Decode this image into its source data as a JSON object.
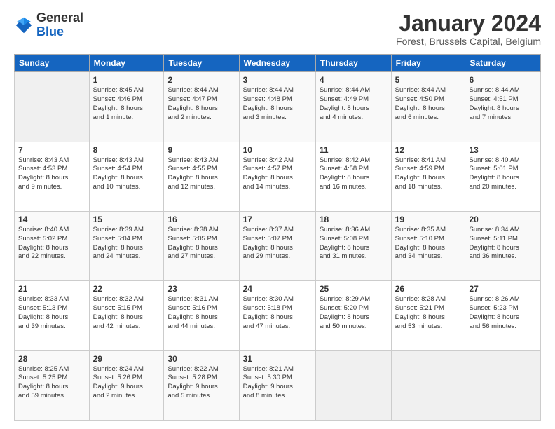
{
  "logo": {
    "general": "General",
    "blue": "Blue"
  },
  "header": {
    "title": "January 2024",
    "subtitle": "Forest, Brussels Capital, Belgium"
  },
  "days_of_week": [
    "Sunday",
    "Monday",
    "Tuesday",
    "Wednesday",
    "Thursday",
    "Friday",
    "Saturday"
  ],
  "weeks": [
    [
      {
        "day": "",
        "text": ""
      },
      {
        "day": "1",
        "text": "Sunrise: 8:45 AM\nSunset: 4:46 PM\nDaylight: 8 hours\nand 1 minute."
      },
      {
        "day": "2",
        "text": "Sunrise: 8:44 AM\nSunset: 4:47 PM\nDaylight: 8 hours\nand 2 minutes."
      },
      {
        "day": "3",
        "text": "Sunrise: 8:44 AM\nSunset: 4:48 PM\nDaylight: 8 hours\nand 3 minutes."
      },
      {
        "day": "4",
        "text": "Sunrise: 8:44 AM\nSunset: 4:49 PM\nDaylight: 8 hours\nand 4 minutes."
      },
      {
        "day": "5",
        "text": "Sunrise: 8:44 AM\nSunset: 4:50 PM\nDaylight: 8 hours\nand 6 minutes."
      },
      {
        "day": "6",
        "text": "Sunrise: 8:44 AM\nSunset: 4:51 PM\nDaylight: 8 hours\nand 7 minutes."
      }
    ],
    [
      {
        "day": "7",
        "text": "Sunrise: 8:43 AM\nSunset: 4:53 PM\nDaylight: 8 hours\nand 9 minutes."
      },
      {
        "day": "8",
        "text": "Sunrise: 8:43 AM\nSunset: 4:54 PM\nDaylight: 8 hours\nand 10 minutes."
      },
      {
        "day": "9",
        "text": "Sunrise: 8:43 AM\nSunset: 4:55 PM\nDaylight: 8 hours\nand 12 minutes."
      },
      {
        "day": "10",
        "text": "Sunrise: 8:42 AM\nSunset: 4:57 PM\nDaylight: 8 hours\nand 14 minutes."
      },
      {
        "day": "11",
        "text": "Sunrise: 8:42 AM\nSunset: 4:58 PM\nDaylight: 8 hours\nand 16 minutes."
      },
      {
        "day": "12",
        "text": "Sunrise: 8:41 AM\nSunset: 4:59 PM\nDaylight: 8 hours\nand 18 minutes."
      },
      {
        "day": "13",
        "text": "Sunrise: 8:40 AM\nSunset: 5:01 PM\nDaylight: 8 hours\nand 20 minutes."
      }
    ],
    [
      {
        "day": "14",
        "text": "Sunrise: 8:40 AM\nSunset: 5:02 PM\nDaylight: 8 hours\nand 22 minutes."
      },
      {
        "day": "15",
        "text": "Sunrise: 8:39 AM\nSunset: 5:04 PM\nDaylight: 8 hours\nand 24 minutes."
      },
      {
        "day": "16",
        "text": "Sunrise: 8:38 AM\nSunset: 5:05 PM\nDaylight: 8 hours\nand 27 minutes."
      },
      {
        "day": "17",
        "text": "Sunrise: 8:37 AM\nSunset: 5:07 PM\nDaylight: 8 hours\nand 29 minutes."
      },
      {
        "day": "18",
        "text": "Sunrise: 8:36 AM\nSunset: 5:08 PM\nDaylight: 8 hours\nand 31 minutes."
      },
      {
        "day": "19",
        "text": "Sunrise: 8:35 AM\nSunset: 5:10 PM\nDaylight: 8 hours\nand 34 minutes."
      },
      {
        "day": "20",
        "text": "Sunrise: 8:34 AM\nSunset: 5:11 PM\nDaylight: 8 hours\nand 36 minutes."
      }
    ],
    [
      {
        "day": "21",
        "text": "Sunrise: 8:33 AM\nSunset: 5:13 PM\nDaylight: 8 hours\nand 39 minutes."
      },
      {
        "day": "22",
        "text": "Sunrise: 8:32 AM\nSunset: 5:15 PM\nDaylight: 8 hours\nand 42 minutes."
      },
      {
        "day": "23",
        "text": "Sunrise: 8:31 AM\nSunset: 5:16 PM\nDaylight: 8 hours\nand 44 minutes."
      },
      {
        "day": "24",
        "text": "Sunrise: 8:30 AM\nSunset: 5:18 PM\nDaylight: 8 hours\nand 47 minutes."
      },
      {
        "day": "25",
        "text": "Sunrise: 8:29 AM\nSunset: 5:20 PM\nDaylight: 8 hours\nand 50 minutes."
      },
      {
        "day": "26",
        "text": "Sunrise: 8:28 AM\nSunset: 5:21 PM\nDaylight: 8 hours\nand 53 minutes."
      },
      {
        "day": "27",
        "text": "Sunrise: 8:26 AM\nSunset: 5:23 PM\nDaylight: 8 hours\nand 56 minutes."
      }
    ],
    [
      {
        "day": "28",
        "text": "Sunrise: 8:25 AM\nSunset: 5:25 PM\nDaylight: 8 hours\nand 59 minutes."
      },
      {
        "day": "29",
        "text": "Sunrise: 8:24 AM\nSunset: 5:26 PM\nDaylight: 9 hours\nand 2 minutes."
      },
      {
        "day": "30",
        "text": "Sunrise: 8:22 AM\nSunset: 5:28 PM\nDaylight: 9 hours\nand 5 minutes."
      },
      {
        "day": "31",
        "text": "Sunrise: 8:21 AM\nSunset: 5:30 PM\nDaylight: 9 hours\nand 8 minutes."
      },
      {
        "day": "",
        "text": ""
      },
      {
        "day": "",
        "text": ""
      },
      {
        "day": "",
        "text": ""
      }
    ]
  ]
}
